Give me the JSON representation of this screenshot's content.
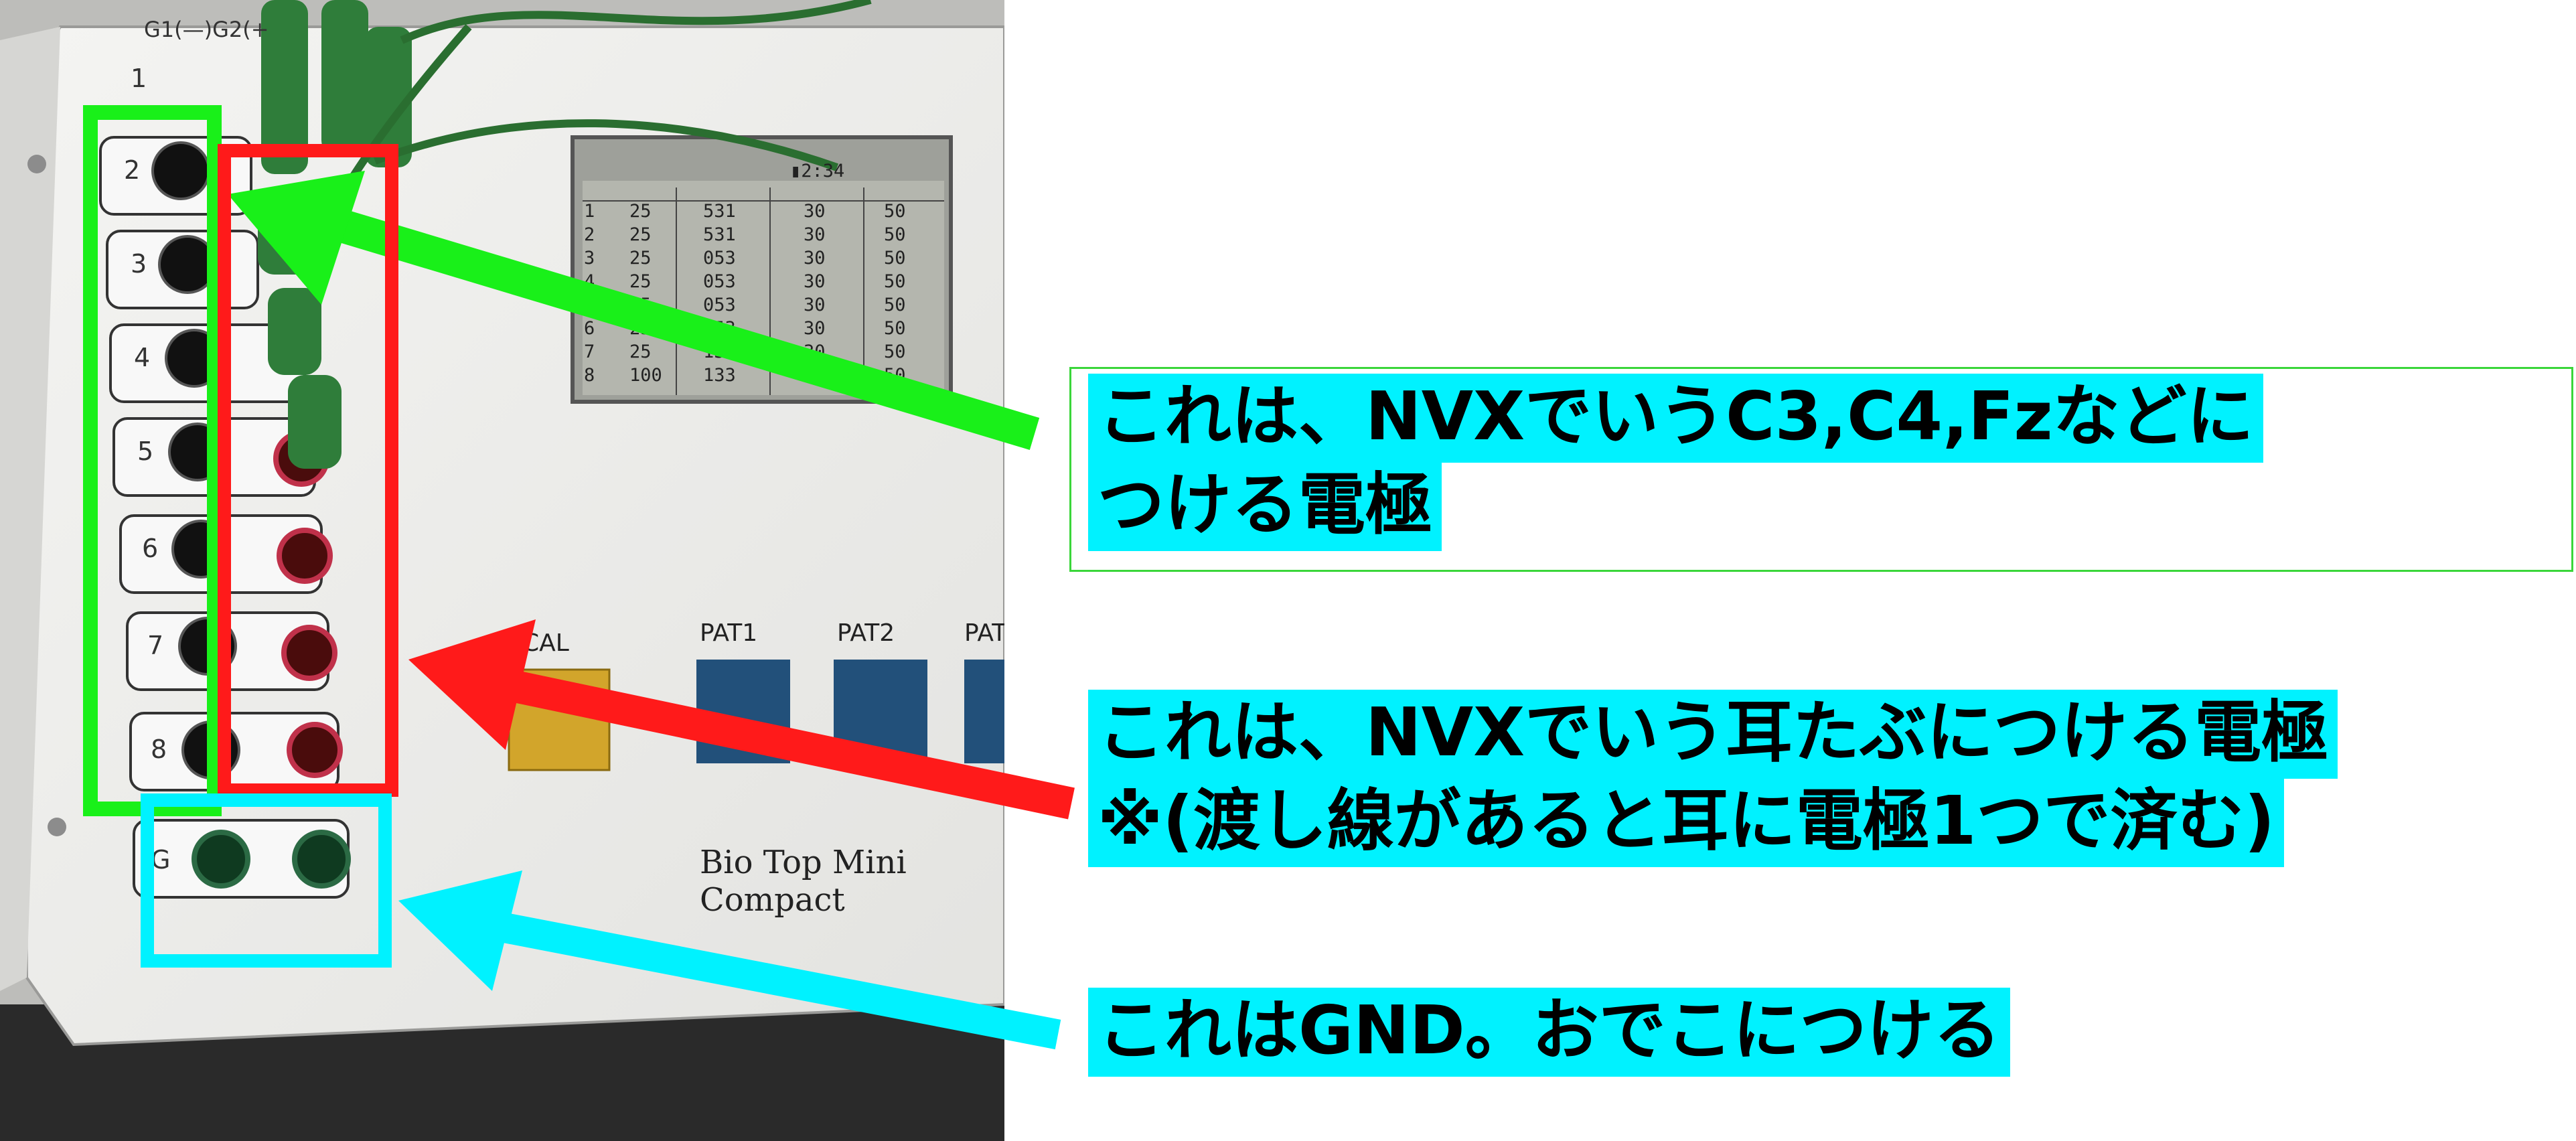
{
  "device": {
    "brand": "Bio Top Mini Compact",
    "top_labels": [
      "G1(—)G2(+"
    ],
    "channel_numbers": [
      "1",
      "2",
      "3",
      "4",
      "5",
      "6",
      "7",
      "8"
    ],
    "ground_label": "G",
    "buttons": [
      "CAL",
      "PAT1",
      "PAT2",
      "PAT"
    ]
  },
  "lcd": {
    "header": "▮2:34",
    "rows": [
      {
        "ch": "1",
        "a": "25",
        "b": "531",
        "c": "30",
        "d": "50"
      },
      {
        "ch": "2",
        "a": "25",
        "b": "531",
        "c": "30",
        "d": "50"
      },
      {
        "ch": "3",
        "a": "25",
        "b": "053",
        "c": "30",
        "d": "50"
      },
      {
        "ch": "4",
        "a": "25",
        "b": "053",
        "c": "30",
        "d": "50"
      },
      {
        "ch": "5",
        "a": "25",
        "b": "053",
        "c": "30",
        "d": "50"
      },
      {
        "ch": "6",
        "a": "25",
        "b": "053",
        "c": "30",
        "d": "50"
      },
      {
        "ch": "7",
        "a": "25",
        "b": "133",
        "c": "30",
        "d": "50"
      },
      {
        "ch": "8",
        "a": "100",
        "b": "133",
        "c": "30",
        "d": "50"
      }
    ]
  },
  "annotations": {
    "green": {
      "line1": "これは、NVXでいうC3,C4,Fzなどに",
      "line2": "つける電極",
      "color": "#19f019"
    },
    "red": {
      "line1": "これは、NVXでいう耳たぶにつける電極",
      "line2": "※(渡し線があると耳に電極1つで済む)",
      "color": "#ff1a1a"
    },
    "cyan": {
      "line1": "これはGND。おでこにつける",
      "color": "#00f2ff"
    }
  }
}
